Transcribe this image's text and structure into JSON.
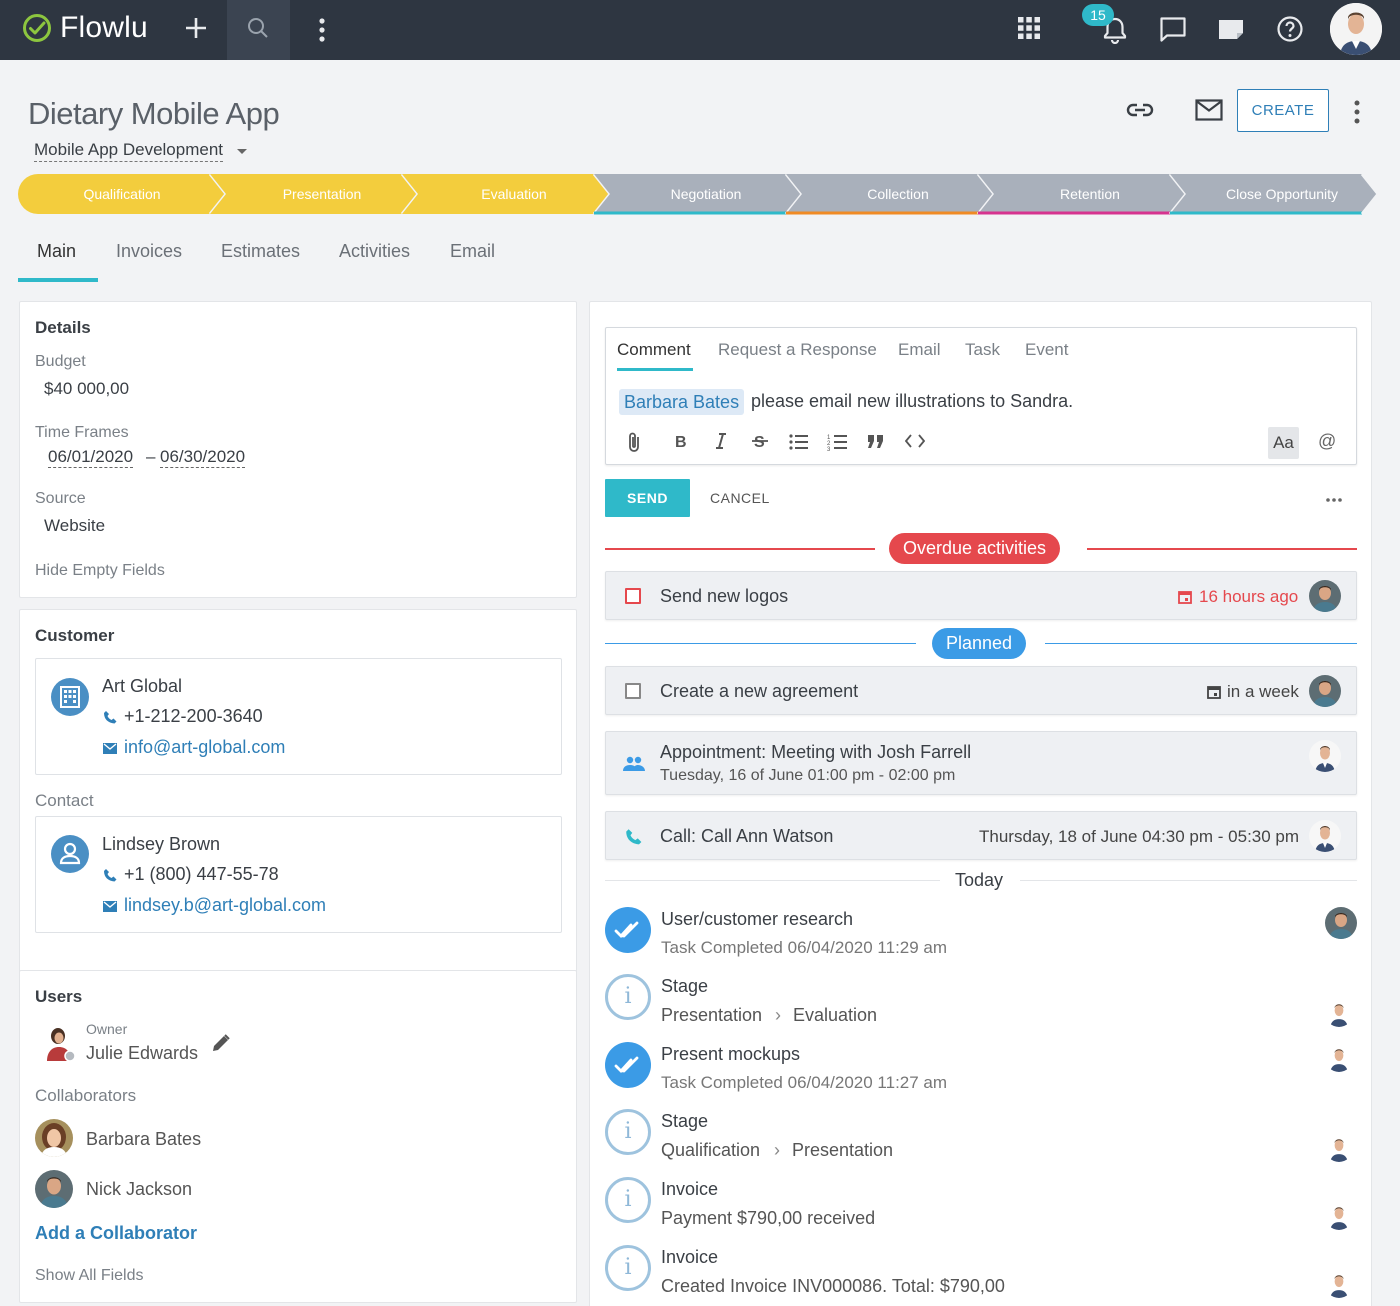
{
  "app": {
    "logo_text": "Flowlu",
    "notification_count": "15"
  },
  "deal": {
    "title": "Dietary Mobile App",
    "pipeline": "Mobile App Development",
    "create_label": "CREATE"
  },
  "stages": [
    {
      "label": "Qualification",
      "state": "done"
    },
    {
      "label": "Presentation",
      "state": "done"
    },
    {
      "label": "Evaluation",
      "state": "done"
    },
    {
      "label": "Negotiation",
      "state": "pending",
      "accent": "#2fb9c9"
    },
    {
      "label": "Collection",
      "state": "pending",
      "accent": "#f08a24"
    },
    {
      "label": "Retention",
      "state": "pending",
      "accent": "#d6338f"
    },
    {
      "label": "Close Opportunity",
      "state": "pending",
      "accent": "#2fb9c9"
    }
  ],
  "tabs": [
    "Main",
    "Invoices",
    "Estimates",
    "Activities",
    "Email"
  ],
  "details": {
    "title": "Details",
    "budget_label": "Budget",
    "budget_value": "$40 000,00",
    "timeframes_label": "Time Frames",
    "start_date": "06/01/2020",
    "dash": "–",
    "end_date": "06/30/2020",
    "source_label": "Source",
    "source_value": "Website",
    "hide_empty": "Hide Empty Fields"
  },
  "customer": {
    "title": "Customer",
    "company": "Art Global",
    "phone": "+1-212-200-3640",
    "email": "info@art-global.com",
    "contact_label": "Contact",
    "contact_name": "Lindsey Brown",
    "contact_phone": "+1 (800) 447-55-78",
    "contact_email": "lindsey.b@art-global.com"
  },
  "users": {
    "title": "Users",
    "owner_label": "Owner",
    "owner_name": "Julie Edwards",
    "collaborators_label": "Collaborators",
    "collaborators": [
      "Barbara Bates",
      "Nick Jackson"
    ],
    "add_collaborator": "Add a Collaborator",
    "show_all": "Show All Fields"
  },
  "composer": {
    "tabs": [
      "Comment",
      "Request a Response",
      "Email",
      "Task",
      "Event"
    ],
    "mention": "Barbara Bates",
    "message": "please email new illustrations to Sandra.",
    "aa_label": "Aa",
    "at_label": "@",
    "send_label": "SEND",
    "cancel_label": "CANCEL"
  },
  "activities": {
    "overdue_label": "Overdue activities",
    "overdue_color": "#e5484d",
    "planned_label": "Planned",
    "planned_color": "#3b9be6",
    "overdue": [
      {
        "title": "Send new logos",
        "due": "16 hours ago"
      }
    ],
    "planned": [
      {
        "title": "Create a new agreement",
        "due": "in a week"
      },
      {
        "title": "Appointment: Meeting with Josh Farrell",
        "when": "Tuesday, 16 of June 01:00 pm - 02:00 pm"
      },
      {
        "title": "Call: Call Ann Watson",
        "when": "Thursday, 18 of June 04:30 pm - 05:30 pm"
      }
    ]
  },
  "feed": {
    "today_label": "Today",
    "items": [
      {
        "type": "done",
        "title": "User/customer research",
        "sub": "Task Completed 06/04/2020 11:29 am"
      },
      {
        "type": "info",
        "title": "Stage",
        "from": "Presentation",
        "to": "Evaluation"
      },
      {
        "type": "done",
        "title": "Present mockups",
        "sub": "Task Completed 06/04/2020 11:27 am"
      },
      {
        "type": "info",
        "title": "Stage",
        "from": "Qualification",
        "to": "Presentation"
      },
      {
        "type": "info",
        "title": "Invoice",
        "sub": "Payment $790,00 received"
      },
      {
        "type": "info",
        "title": "Invoice",
        "sub": "Created Invoice INV000086. Total: $790,00"
      }
    ],
    "arrow": "›"
  }
}
